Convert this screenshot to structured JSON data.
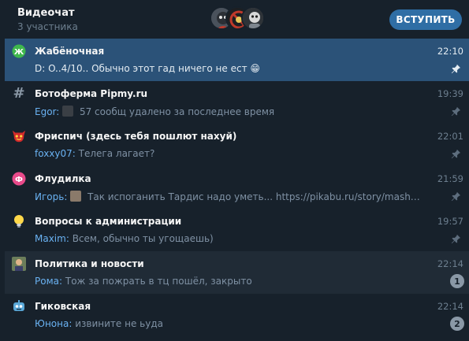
{
  "header": {
    "title": "Видеочат",
    "subtitle": "3 участника",
    "join_label": "ВСТУПИТЬ"
  },
  "chats": [
    {
      "title": "Жабёночная",
      "time": "22:10",
      "sender": "",
      "preview": "D: O..4/10.. Обычно этот гад ничего не ест 😁",
      "pinned": true,
      "icon": "frog-sticker-icon"
    },
    {
      "title": "Ботоферма Pipmy.ru",
      "time": "19:39",
      "sender": "Egor:",
      "preview": "57 сообщ удалено за последнее время",
      "pinned": true,
      "icon": "hashtag-icon"
    },
    {
      "title": "Фриспич (здесь тебя пошлют нахуй)",
      "time": "22:01",
      "sender": "foxxy07:",
      "preview": "Телега лагает?",
      "pinned": true,
      "icon": "devil-emoji-icon"
    },
    {
      "title": "Флудилка",
      "time": "21:59",
      "sender": "Игорь:",
      "preview": "Так испоганить Тардис надо уметь... https://pikabu.ru/story/mashina_vr...",
      "pinned": true,
      "icon": "flood-circle-icon"
    },
    {
      "title": "Вопросы к администрации",
      "time": "19:57",
      "sender": "Maxim:",
      "preview": "Всем, обычно ты угощаешь)",
      "pinned": true,
      "icon": "lightbulb-icon"
    },
    {
      "title": "Политика и новости",
      "time": "22:14",
      "sender": "Рома:",
      "preview": "Тож за пожрать в тц пошёл, закрыто",
      "badge": "1",
      "icon": "portrait-icon"
    },
    {
      "title": "Гиковская",
      "time": "22:14",
      "sender": "Юнона:",
      "preview": "извините не ьуда",
      "badge": "2",
      "icon": "robot-icon"
    }
  ],
  "colors": {
    "background": "#17212b",
    "selected_row": "#2b5278",
    "accent": "#2f6ea5",
    "sender": "#6ab2f2",
    "muted": "#6d7f8f"
  }
}
